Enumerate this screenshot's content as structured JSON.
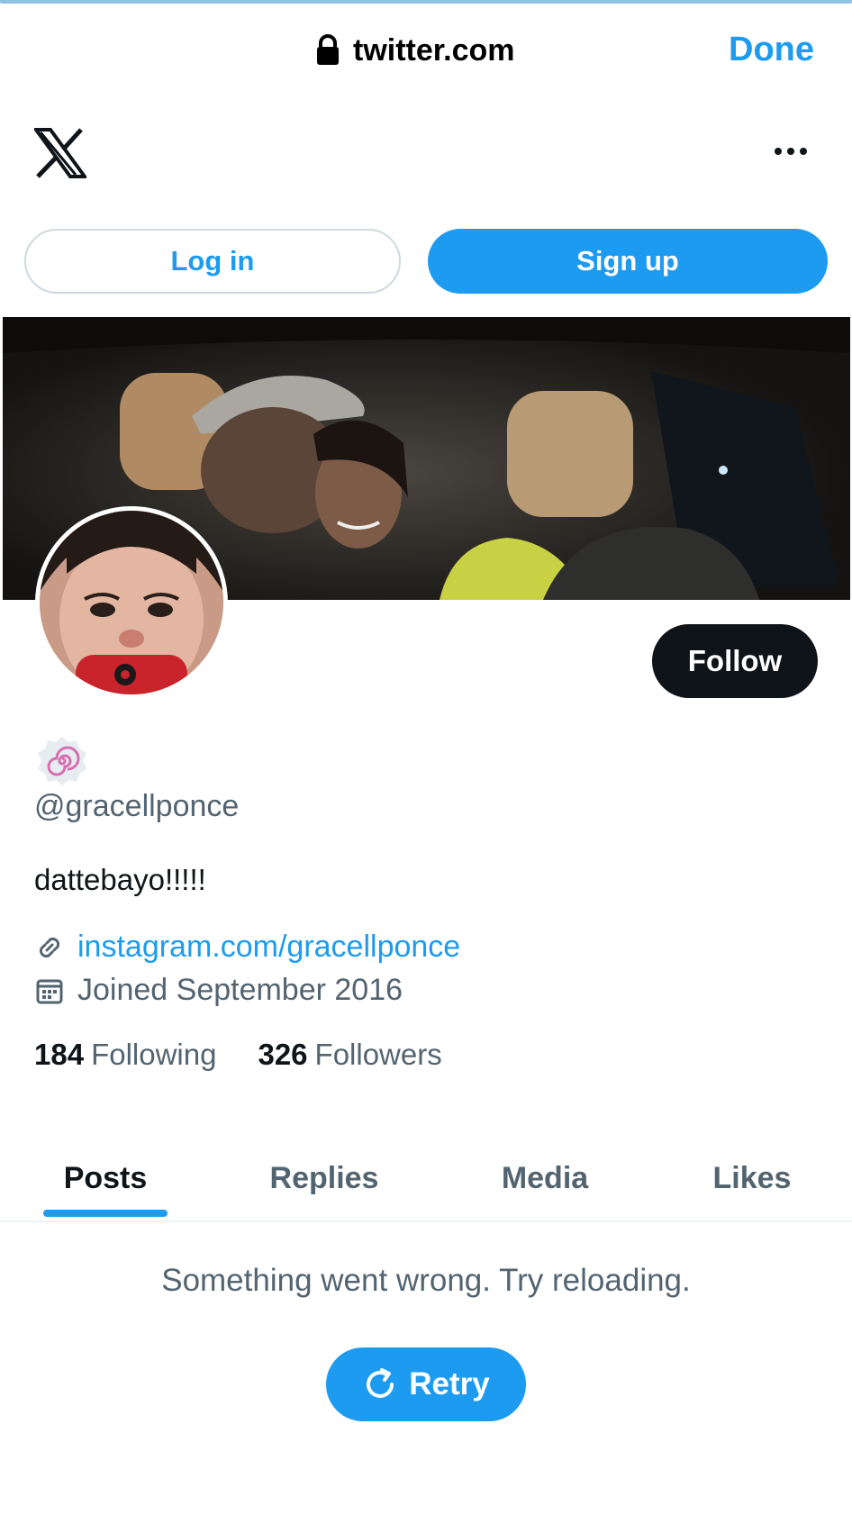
{
  "browser": {
    "url": "twitter.com",
    "done_label": "Done",
    "lock_icon": "lock-icon"
  },
  "header": {
    "logo": "x-logo-icon",
    "more_icon": "more-icon"
  },
  "auth": {
    "login_label": "Log in",
    "signup_label": "Sign up"
  },
  "profile": {
    "follow_label": "Follow",
    "handle": "@gracellponce",
    "bio": "dattebayo!!!!!",
    "link": "instagram.com/gracellponce",
    "joined": "Joined September 2016",
    "following_count": "184",
    "following_label": "Following",
    "followers_count": "326",
    "followers_label": "Followers"
  },
  "tabs": [
    {
      "label": "Posts"
    },
    {
      "label": "Replies"
    },
    {
      "label": "Media"
    },
    {
      "label": "Likes"
    }
  ],
  "feed": {
    "error_text": "Something went wrong. Try reloading.",
    "retry_label": "Retry"
  },
  "colors": {
    "accent": "#1d9bf0",
    "text": "#0f1419",
    "muted": "#536471"
  }
}
